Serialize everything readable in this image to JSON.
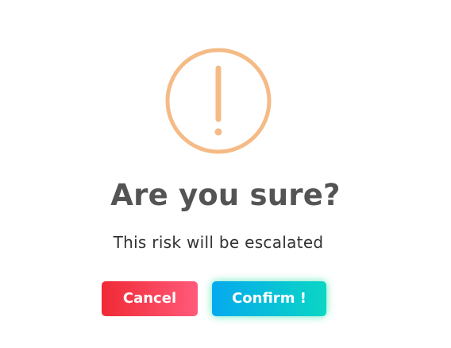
{
  "dialog": {
    "icon": "exclamation-circle-icon",
    "icon_color": "#f5bb86",
    "title": "Are you sure?",
    "message": "This risk will be escalated",
    "cancel_label": "Cancel",
    "confirm_label": "Confirm !",
    "cancel_gradient": [
      "#f02a35",
      "#ff5a7a"
    ],
    "confirm_gradient": [
      "#06a9ee",
      "#0bd6c4"
    ]
  }
}
